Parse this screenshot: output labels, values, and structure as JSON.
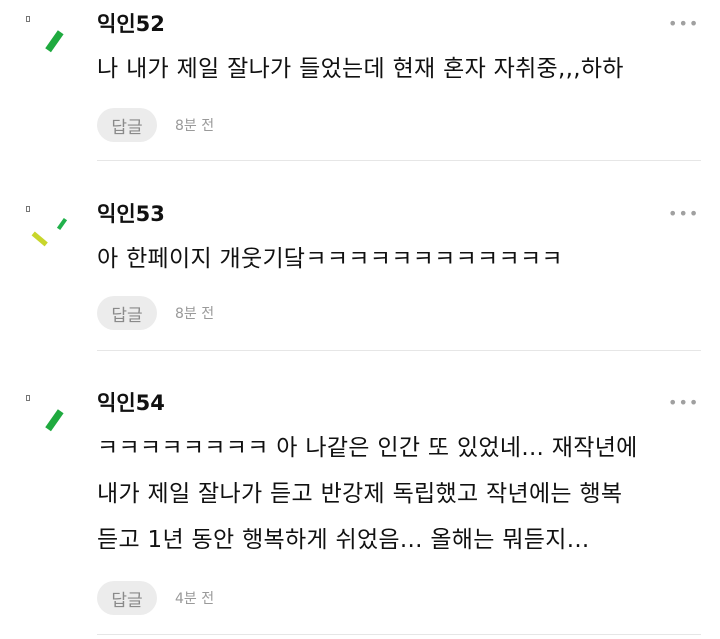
{
  "comments": [
    {
      "author": "익인52",
      "more": "•••",
      "lines": [
        "나 내가 제일 잘나가 들었는데 현재 혼자 자취중,,,하하"
      ],
      "reply_label": "답글",
      "time": "8분 전",
      "avatar_icon": "confetti-avatar-icon",
      "avatar_colors": [
        "#1faa3f"
      ]
    },
    {
      "author": "익인53",
      "more": "•••",
      "lines": [
        "아 한페이지 개웃기닼ㅋㅋㅋㅋㅋㅋㅋㅋㅋㅋㅋㅋ"
      ],
      "reply_label": "답글",
      "time": "8분 전",
      "avatar_icon": "confetti-avatar-icon",
      "avatar_colors": [
        "#22b14c",
        "#c8d62b"
      ]
    },
    {
      "author": "익인54",
      "more": "•••",
      "lines": [
        "ㅋㅋㅋㅋㅋㅋㅋㅋ 아 나같은 인간 또 있었네... 재작년에",
        "내가 제일 잘나가 듣고 반강제 독립했고 작년에는 행복",
        "듣고 1년 동안 행복하게 쉬었음... 올해는 뭐듣지..."
      ],
      "reply_label": "답글",
      "time": "4분 전",
      "avatar_icon": "confetti-avatar-icon",
      "avatar_colors": [
        "#1faa3f"
      ]
    }
  ]
}
